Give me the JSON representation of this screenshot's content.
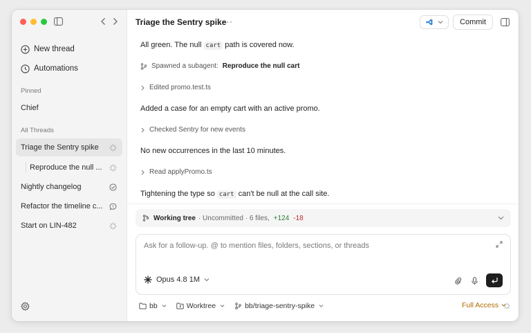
{
  "sidebar": {
    "new_thread": "New thread",
    "automations": "Automations",
    "pinned_label": "Pinned",
    "pinned_item": "Chief",
    "threads_label": "All Threads",
    "threads": [
      {
        "label": "Triage the Sentry spike",
        "status": "spinner",
        "active": true
      },
      {
        "label": "Reproduce the null ...",
        "status": "spinner",
        "sub": true
      },
      {
        "label": "Nightly changelog",
        "status": "check-circle"
      },
      {
        "label": "Refactor the timeline c...",
        "status": "chat-bubble"
      },
      {
        "label": "Start on LIN-482",
        "status": "spinner"
      }
    ]
  },
  "header": {
    "title": "Triage the Sentry spike",
    "more": "···",
    "commit": "Commit"
  },
  "transcript": {
    "line1_pre": "All green. The null",
    "line1_code": "cart",
    "line1_post": "path is covered now.",
    "spawned_prefix": "Spawned a subagent:",
    "spawned_name": "Reproduce the null cart",
    "edited": "Edited promo.test.ts",
    "added": "Added a case for an empty cart with an active promo.",
    "checked": "Checked Sentry for new events",
    "no_new": "No new occurrences in the last 10 minutes.",
    "read": "Read applyPromo.ts",
    "tighten_pre": "Tightening the type so",
    "tighten_code": "cart",
    "tighten_post": "can't be null at the call site."
  },
  "working_tree": {
    "label": "Working tree",
    "summary": "· Uncommitted · 6 files,",
    "additions": "+124",
    "deletions": "-18"
  },
  "composer": {
    "placeholder": "Ask for a follow-up. @ to mention files, folders, sections, or threads",
    "model": "Opus 4.8 1M"
  },
  "footer": {
    "folder": "bb",
    "worktree": "Worktree",
    "branch": "bb/triage-sentry-spike",
    "access": "Full Access"
  },
  "colors": {
    "accent_access": "#b06a00",
    "additions": "#2e7d32",
    "deletions": "#c62828",
    "vscode_blue": "#2f80d1"
  }
}
